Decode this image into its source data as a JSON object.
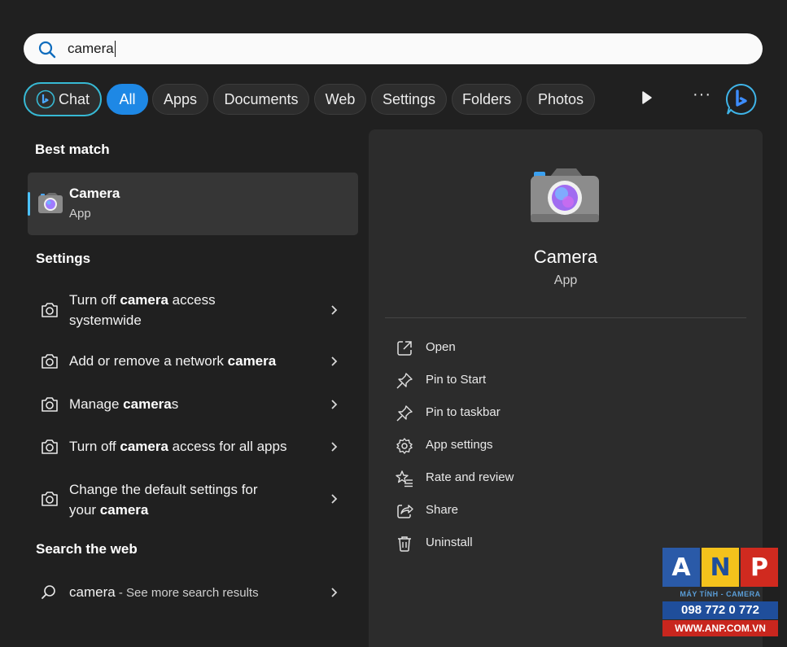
{
  "search": {
    "value": "camera"
  },
  "filters": {
    "chat": "Chat",
    "items": [
      "All",
      "Apps",
      "Documents",
      "Web",
      "Settings",
      "Folders",
      "Photos"
    ],
    "more": "···"
  },
  "left": {
    "best_match_heading": "Best match",
    "best_match": {
      "name": "Camera",
      "type": "App"
    },
    "settings_heading": "Settings",
    "settings": [
      {
        "pre": "Turn off ",
        "bold": "camera",
        "post": " access",
        "line2": "systemwide"
      },
      {
        "pre": "Add or remove a network ",
        "bold": "camera",
        "post": "",
        "line2": ""
      },
      {
        "pre": "Manage ",
        "bold": "camera",
        "post": "s",
        "line2": ""
      },
      {
        "pre": "Turn off ",
        "bold": "camera",
        "post": " access for all apps",
        "line2": ""
      },
      {
        "pre": "Change the default settings for",
        "bold": "",
        "post": "",
        "line2_pre": "your ",
        "line2_bold": "camera"
      }
    ],
    "web_heading": "Search the web",
    "web": {
      "query": "camera",
      "suffix": " - See more search results"
    }
  },
  "panel": {
    "name": "Camera",
    "type": "App",
    "actions": [
      {
        "label": "Open",
        "icon": "open-external-icon"
      },
      {
        "label": "Pin to Start",
        "icon": "pin-icon"
      },
      {
        "label": "Pin to taskbar",
        "icon": "pin-icon"
      },
      {
        "label": "App settings",
        "icon": "gear-icon"
      },
      {
        "label": "Rate and review",
        "icon": "star-list-icon"
      },
      {
        "label": "Share",
        "icon": "share-icon"
      },
      {
        "label": "Uninstall",
        "icon": "trash-icon"
      }
    ]
  },
  "watermark": {
    "letters": [
      "A",
      "N",
      "P"
    ],
    "tagline": "MÁY TÍNH - CAMERA",
    "phone": "098 772 0 772",
    "website": "WWW.ANP.COM.VN"
  },
  "colors": {
    "background": "#202020",
    "panel": "#2c2c2c",
    "accent_blue": "#1e88e5",
    "chat_outline": "#37b9d4",
    "selection_bar": "#4cc2ff"
  }
}
